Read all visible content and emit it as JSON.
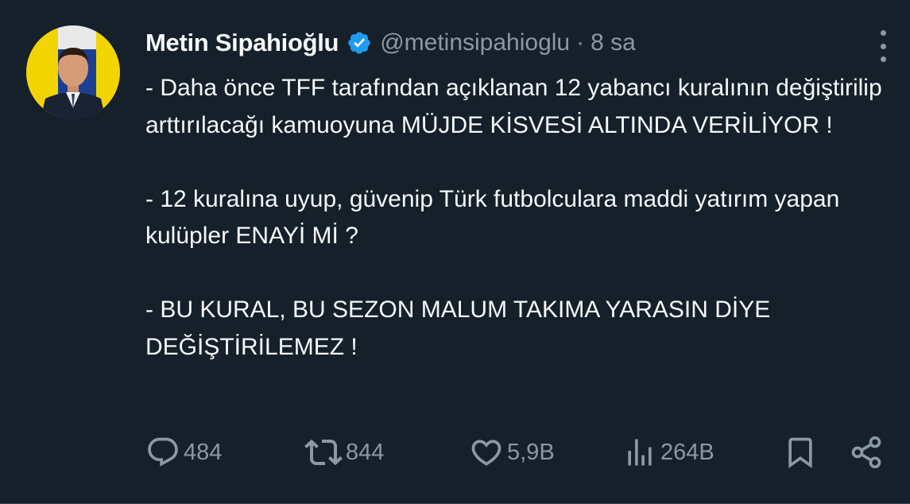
{
  "colors": {
    "background": "#15202b",
    "text": "#f7f9f9",
    "muted": "#8b98a5",
    "verified": "#1d9bf0"
  },
  "author": {
    "name": "Metin Sipahioğlu",
    "handle": "@metinsipahioglu",
    "separator": "·",
    "time": "8 sa",
    "verified": true
  },
  "tweet": {
    "paragraphs": [
      "- Daha önce TFF tarafından açıklanan 12 yabancı kuralının değiştirilip arttırılacağı kamuoyuna MÜJDE KİSVESİ ALTINDA VERİLİYOR !",
      "- 12 kuralına uyup, güvenip Türk futbolculara maddi yatırım yapan kulüpler ENAYİ Mİ ?",
      "- BU KURAL, BU SEZON MALUM TAKIMA YARASIN DİYE DEĞİŞTİRİLEMEZ !"
    ]
  },
  "actions": {
    "replies": "484",
    "retweets": "844",
    "likes": "5,9B",
    "views": "264B"
  },
  "icons": [
    "more-icon",
    "verified-badge-icon",
    "reply-icon",
    "retweet-icon",
    "like-icon",
    "views-icon",
    "bookmark-icon",
    "share-icon"
  ]
}
